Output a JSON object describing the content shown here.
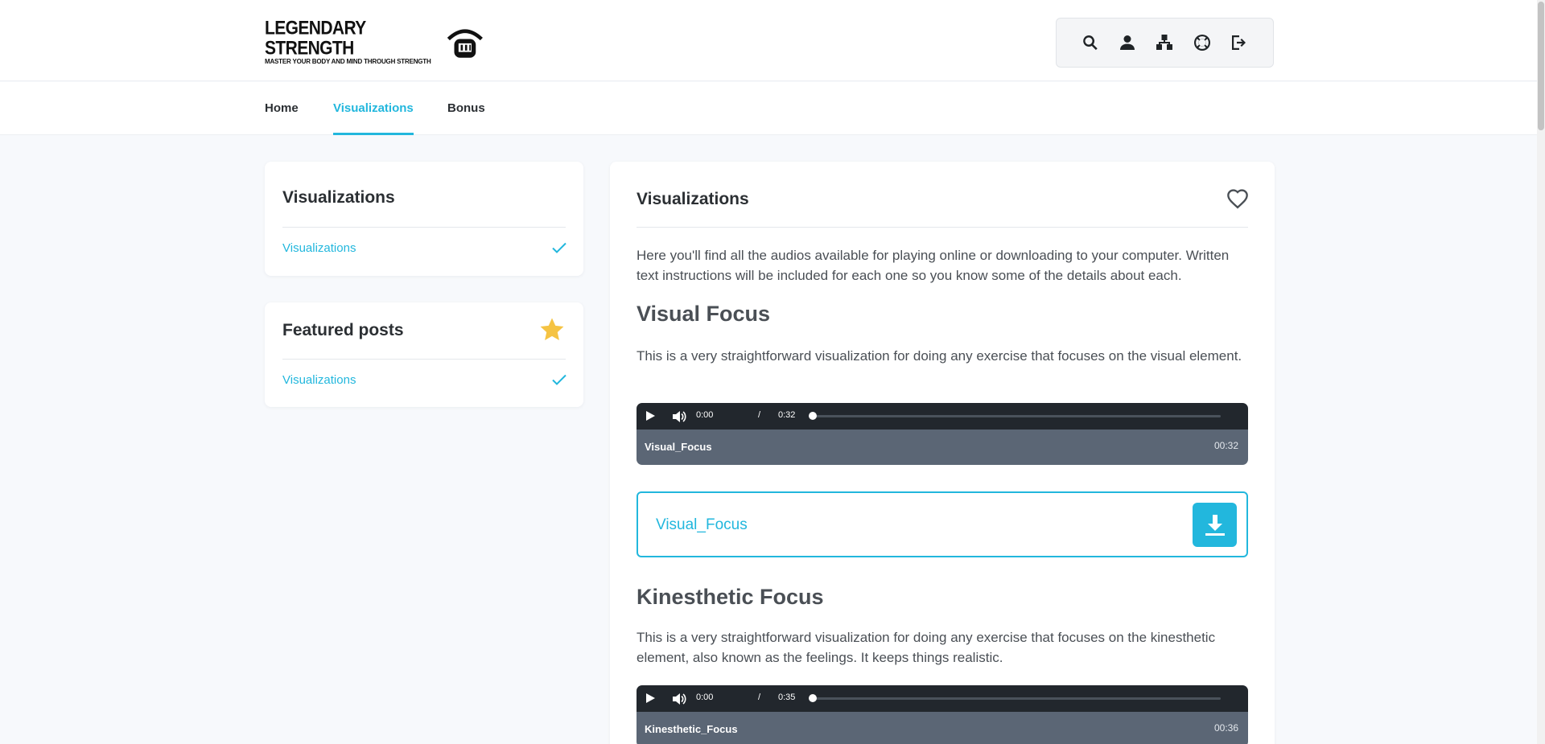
{
  "brand": {
    "title": "LEGENDARY STRENGTH",
    "tagline": "MASTER YOUR BODY AND MIND THROUGH STRENGTH"
  },
  "colors": {
    "accent": "#22b7dd",
    "star": "#f5c343",
    "player_dark": "#22272d",
    "player_meta": "#5b6675"
  },
  "toolbar": {
    "icons": [
      "search-icon",
      "user-icon",
      "sitemap-icon",
      "lifebuoy-icon",
      "logout-icon"
    ]
  },
  "nav": {
    "items": [
      {
        "label": "Home",
        "active": false
      },
      {
        "label": "Visualizations",
        "active": true
      },
      {
        "label": "Bonus",
        "active": false
      }
    ]
  },
  "sidebar": {
    "categories": {
      "title": "Visualizations",
      "link": "Visualizations"
    },
    "featured": {
      "title": "Featured posts",
      "link": "Visualizations"
    }
  },
  "main": {
    "title": "Visualizations",
    "intro": "Here you'll find all the audios available for playing online or downloading to your computer. Written text instructions will be included for each one so you know some of the details about each.",
    "sections": [
      {
        "heading": "Visual Focus",
        "description": "This is a very straightforward visualization for doing any exercise that focuses on the visual element.",
        "player": {
          "current": "0:00",
          "separator": "/",
          "total": "0:32",
          "name": "Visual_Focus",
          "duration": "00:32"
        },
        "download_label": "Visual_Focus"
      },
      {
        "heading": "Kinesthetic Focus",
        "description": "This is a very straightforward visualization for doing any exercise that focuses on the kinesthetic element, also known as the feelings. It keeps things realistic.",
        "player": {
          "current": "0:00",
          "separator": "/",
          "total": "0:35",
          "name": "Kinesthetic_Focus",
          "duration": "00:36"
        }
      }
    ]
  }
}
